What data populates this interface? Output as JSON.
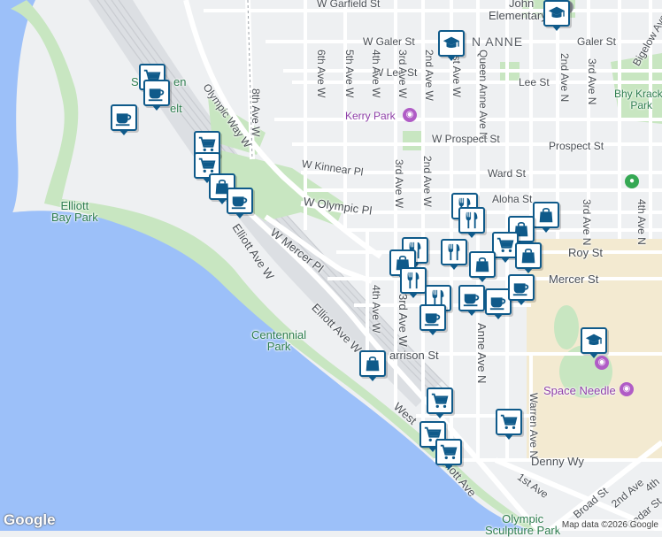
{
  "map": {
    "attribution": "Map data ©2026 Google",
    "google_logo": "Google",
    "colors": {
      "water": "#9cc0f9",
      "park": "#c8e6c1",
      "road": "#ffffff",
      "land": "#eef0f2",
      "marker_border": "#0f5a8a",
      "marker_icon": "#0f5a8a",
      "rail": "#c9ccd1",
      "campus": "#f3ead1"
    }
  },
  "labels": {
    "w_garfield_st": "W Garfield St",
    "w_galer_st": "W Galer St",
    "galer_st": "Galer St",
    "queen_anne": "N ANNE",
    "john_elementary": "John",
    "elementary_school": "Elementary Sch",
    "w_lee_st": "W Lee St",
    "lee_st": "Lee St",
    "olympic_way_w": "Olympic Way W",
    "eighth_ave_w": "8th Ave W",
    "sixth_ave_w": "6th Ave W",
    "fifth_ave_w": "5th Ave W",
    "fourth_ave_w_top": "4th Ave W",
    "third_ave_w_top": "3rd Ave W",
    "second_ave_w_top": "2nd Ave W",
    "first_ave_w_top": "1st Ave W",
    "queen_anne_ave_n": "Queen Anne Ave N",
    "second_ave_n_top": "2nd Ave N",
    "third_ave_n_top": "3rd Ave N",
    "bigelow_ave_n": "Bigelow Ave N",
    "bhy_kracke_park_1": "Bhy Kracke",
    "bhy_kracke_park_2": "Park",
    "kerry_park": "Kerry Park",
    "w_prospect_st": "W Prospect St",
    "prospect_st": "Prospect St",
    "w_kinnear_pl": "W Kinnear Pl",
    "ward_st": "Ward St",
    "third_ave_w_mid": "3rd Ave W",
    "second_ave_w_mid": "2nd Ave W",
    "aloha_st": "Aloha St",
    "w_olympic_pl": "W Olympic Pl",
    "third_ave_n_right": "3rd Ave N",
    "fourth_ave_n_right": "4th Ave N",
    "roy_st": "Roy St",
    "mercer_st": "Mercer St",
    "w_mercer_pl": "W Mercer Pl",
    "elliott_ave_w_1": "Elliott Ave W",
    "elliott_ave_w_2": "Elliott Ave W",
    "fourth_ave_w_low": "4th Ave W",
    "third_ave_w_low": "3rd Ave W",
    "harrison_st": "arrison St",
    "anne_ave_n": "Anne Ave N",
    "centennial_park_1": "Centennial",
    "centennial_park_2": "Park",
    "elliott_bay_park_1": "Elliott",
    "elliott_bay_park_2": "Bay Park",
    "space_needle": "Space Needle",
    "warren_ave_n": "Warren Ave N",
    "west_st": "West",
    "denny_wy": "Denny Wy",
    "first_ave": "1st Ave",
    "elliott_ave": "liott Ave",
    "broad_st": "Broad St",
    "second_ave": "2nd Ave",
    "fourth_ave": "4th",
    "cedar_st": "Cedar St",
    "olympic_sculpture_park_1": "Olympic",
    "olympic_sculpture_park_2": "Sculpture Park",
    "smith_cove_1": "S",
    "smith_cove_2": "en",
    "smith_cove_3": "elt"
  },
  "markers": [
    {
      "id": "m1",
      "icon": "school-icon"
    },
    {
      "id": "m2",
      "icon": "school-icon"
    },
    {
      "id": "m3",
      "icon": "shopping-cart-icon"
    },
    {
      "id": "m4",
      "icon": "coffee-cup-icon"
    },
    {
      "id": "m5",
      "icon": "coffee-cup-icon"
    },
    {
      "id": "m6",
      "icon": "shopping-cart-icon"
    },
    {
      "id": "m7",
      "icon": "shopping-cart-icon"
    },
    {
      "id": "m8",
      "icon": "shopping-bag-icon"
    },
    {
      "id": "m9",
      "icon": "coffee-cup-icon"
    },
    {
      "id": "m10",
      "icon": "shopping-bag-icon"
    },
    {
      "id": "m11",
      "icon": "restaurant-icon"
    },
    {
      "id": "m12",
      "icon": "restaurant-icon"
    },
    {
      "id": "m13",
      "icon": "shopping-bag-icon"
    },
    {
      "id": "m14",
      "icon": "restaurant-icon"
    },
    {
      "id": "m15",
      "icon": "shopping-cart-icon"
    },
    {
      "id": "m16",
      "icon": "shopping-bag-icon"
    },
    {
      "id": "m17",
      "icon": "restaurant-icon"
    },
    {
      "id": "m18",
      "icon": "shopping-bag-icon"
    },
    {
      "id": "m19",
      "icon": "shopping-bag-icon"
    },
    {
      "id": "m20",
      "icon": "restaurant-icon"
    },
    {
      "id": "m21",
      "icon": "restaurant-icon"
    },
    {
      "id": "m22",
      "icon": "coffee-cup-icon"
    },
    {
      "id": "m23",
      "icon": "coffee-cup-icon"
    },
    {
      "id": "m24",
      "icon": "coffee-cup-icon"
    },
    {
      "id": "m25",
      "icon": "coffee-cup-icon"
    },
    {
      "id": "m26",
      "icon": "shopping-bag-icon"
    },
    {
      "id": "m27",
      "icon": "school-icon"
    },
    {
      "id": "m28",
      "icon": "shopping-cart-icon"
    },
    {
      "id": "m29",
      "icon": "shopping-cart-icon"
    },
    {
      "id": "m30",
      "icon": "shopping-cart-icon"
    },
    {
      "id": "m31",
      "icon": "shopping-cart-icon"
    }
  ]
}
